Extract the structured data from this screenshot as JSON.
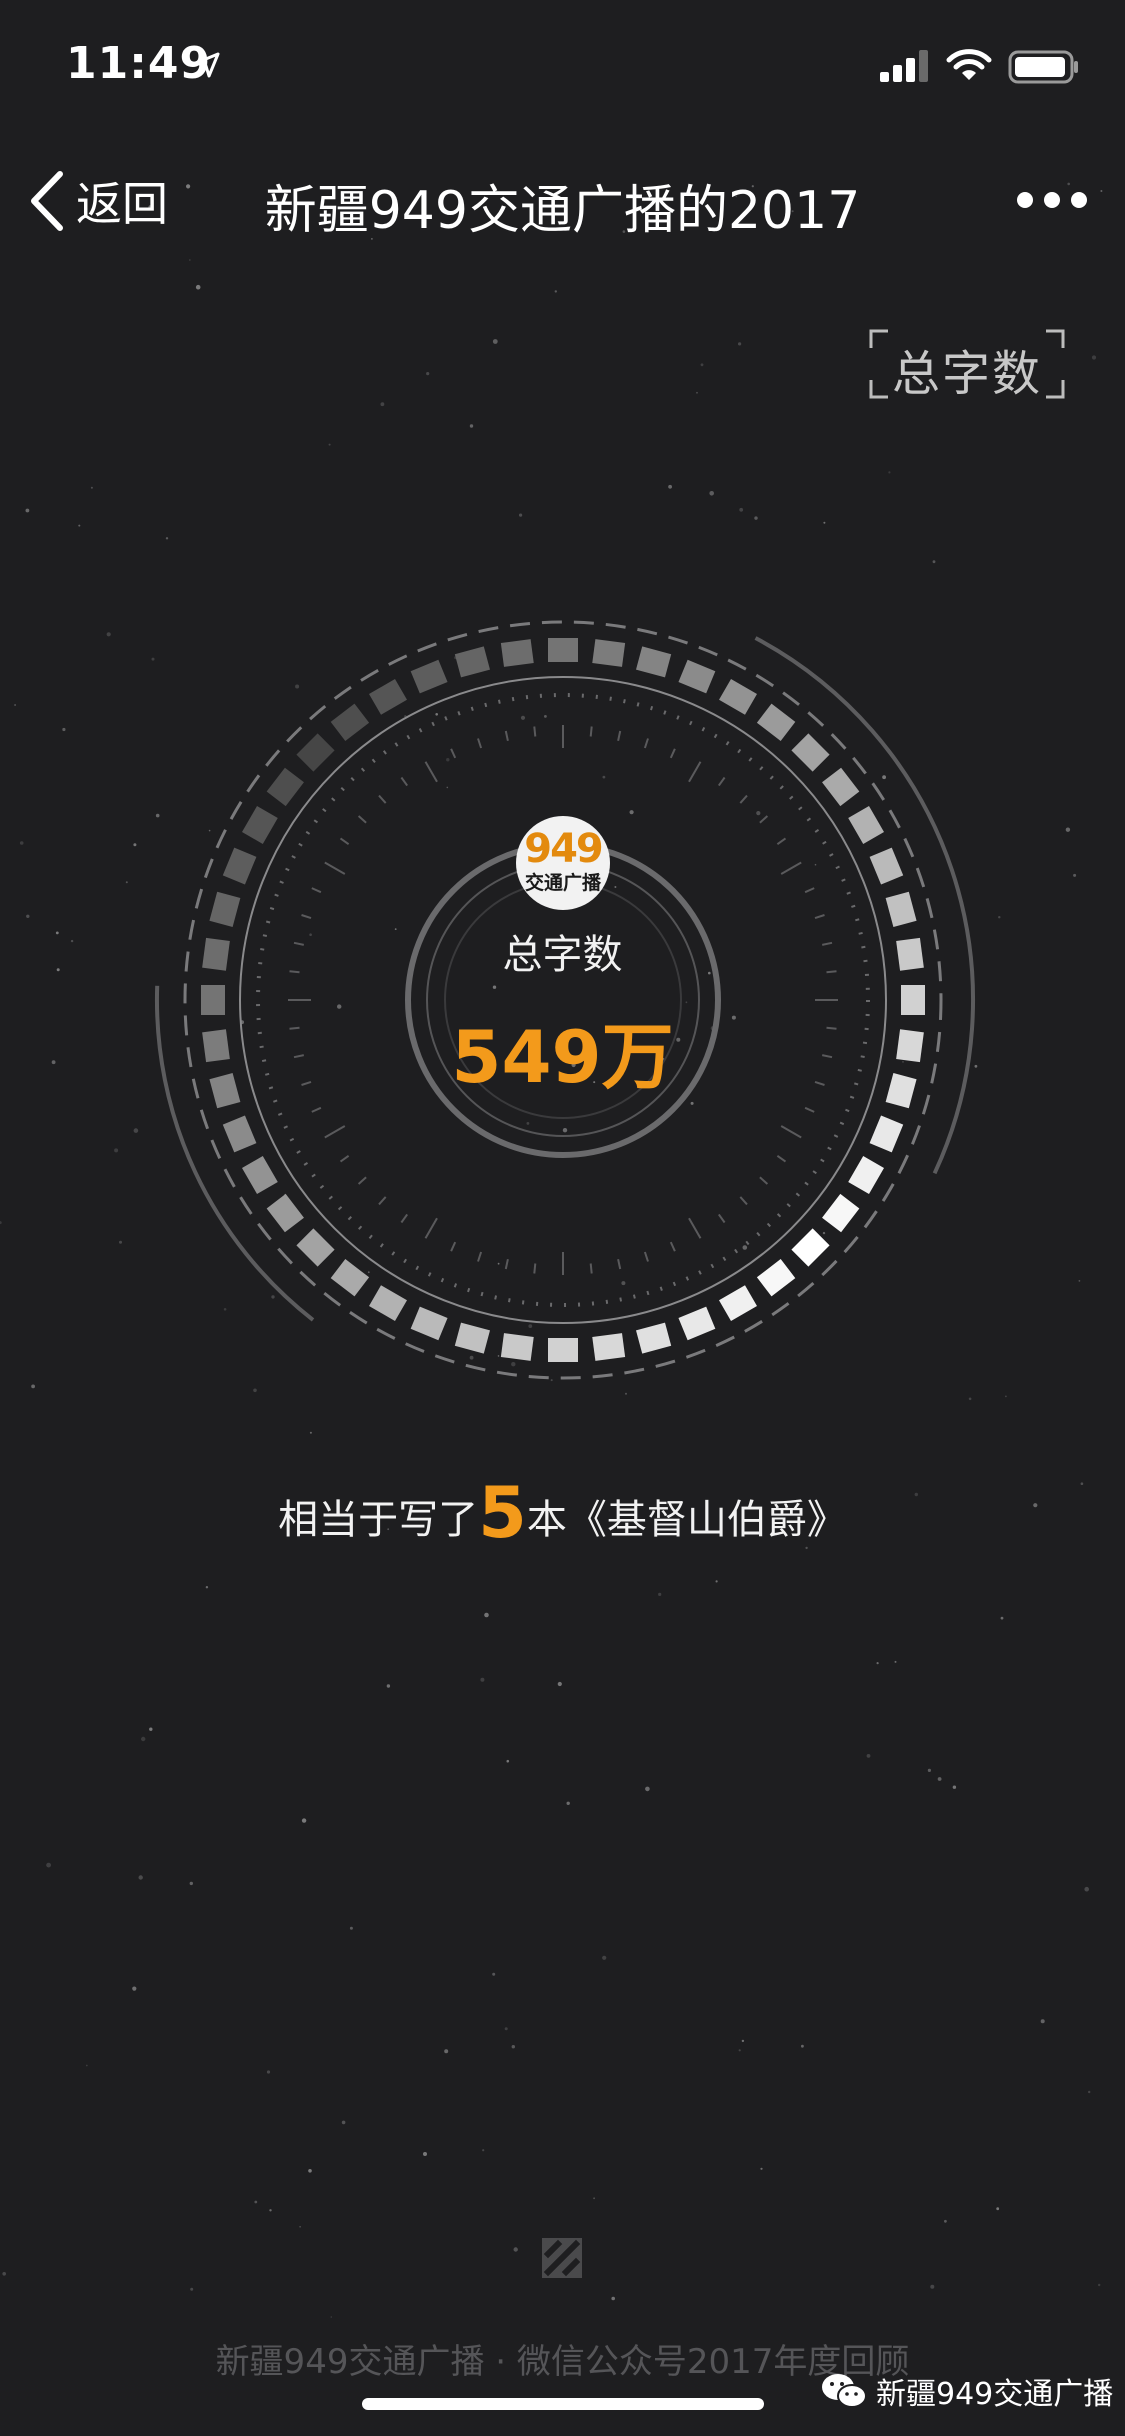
{
  "status_bar": {
    "time": "11:49"
  },
  "nav": {
    "back_label": "返回",
    "title": "新疆949交通广播的2017"
  },
  "corner_label": "总字数",
  "logo": {
    "number": "949",
    "subtitle": "交通广播"
  },
  "stat": {
    "label": "总字数",
    "value": "549万"
  },
  "caption": {
    "prefix": "相当于写了",
    "number": "5",
    "suffix": "本《基督山伯爵》"
  },
  "footer": {
    "text": "新疆949交通广播 · 微信公众号2017年度回顾"
  },
  "watermark": {
    "text": "新疆949交通广播"
  },
  "colors": {
    "background": "#1e1e20",
    "accent": "#f39a1b"
  }
}
